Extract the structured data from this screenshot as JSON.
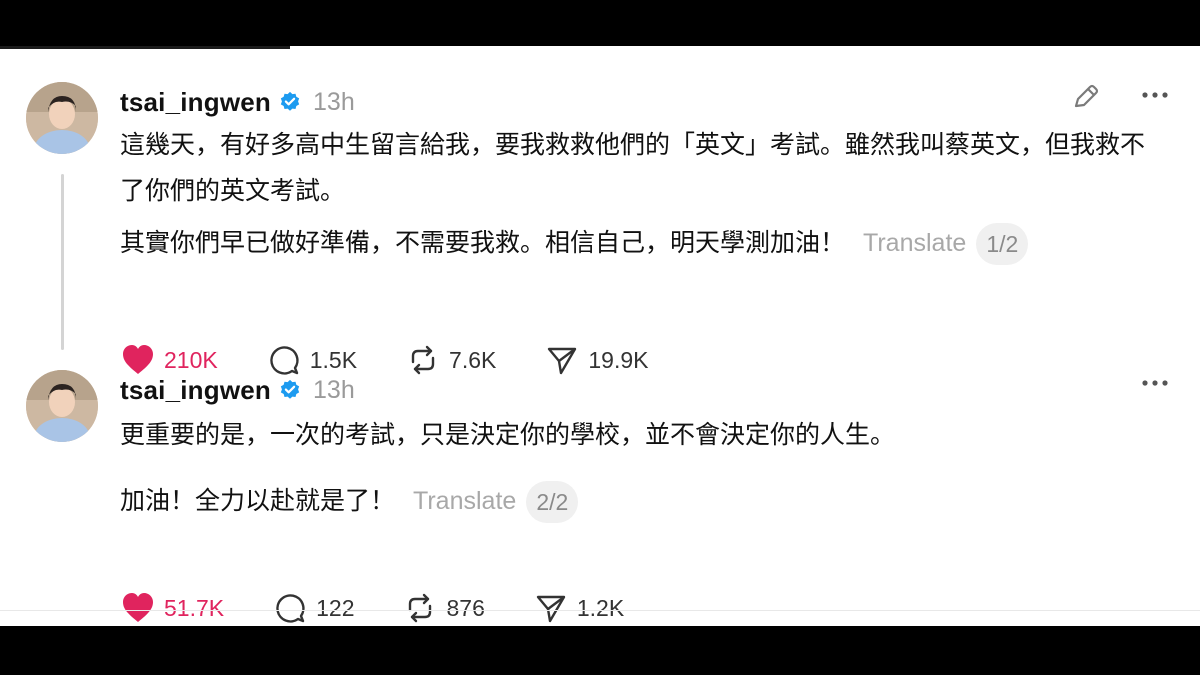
{
  "posts": [
    {
      "username": "tsai_ingwen",
      "time": "13h",
      "paragraph1": "這幾天，有好多高中生留言給我，要我救救他們的「英文」考試。雖然我叫蔡英文，但我救不了你們的英文考試。",
      "paragraph2": "其實你們早已做好準備，不需要我救。相信自己，明天學測加油！",
      "translate_label": "Translate",
      "page": "1/2",
      "likes": "210K",
      "replies": "1.5K",
      "reposts": "7.6K",
      "shares": "19.9K",
      "liked": true,
      "show_edit": true
    },
    {
      "username": "tsai_ingwen",
      "time": "13h",
      "paragraph1": "更重要的是，一次的考試，只是決定你的學校，並不會決定你的人生。",
      "paragraph2": "加油！全力以赴就是了！",
      "translate_label": "Translate",
      "page": "2/2",
      "likes": "51.7K",
      "replies": "122",
      "reposts": "876",
      "shares": "1.2K",
      "liked": true,
      "show_edit": false
    }
  ],
  "colors": {
    "like": "#e0245e",
    "verified": "#1d9bf0",
    "muted": "#9a9a9a"
  },
  "icons": [
    "verified-badge-icon",
    "edit-icon",
    "more-icon",
    "heart-icon",
    "reply-icon",
    "repost-icon",
    "share-icon"
  ]
}
